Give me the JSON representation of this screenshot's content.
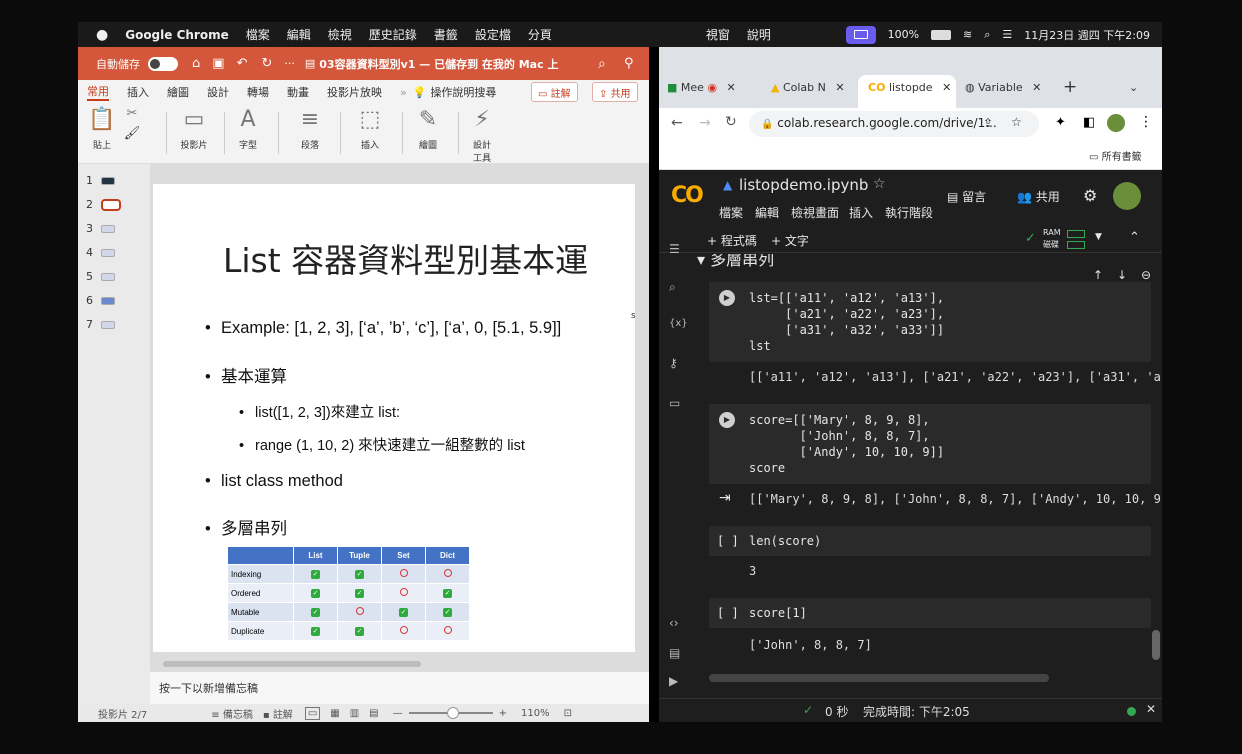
{
  "menubar": {
    "apple": "",
    "app": "Google Chrome",
    "items": [
      "檔案",
      "編輯",
      "檢視",
      "歷史記錄",
      "書籤",
      "設定檔",
      "分頁"
    ],
    "items_right": [
      "視窗",
      "說明"
    ],
    "battery": "100%",
    "datetime": "11月23日 週四 下午2:09"
  },
  "ppt": {
    "autosave": "自動儲存",
    "toggle_state": "關閉",
    "doc_title": "03容器資料型別v1 — 已儲存到 在我的 Mac 上",
    "tabs": [
      "常用",
      "插入",
      "繪圖",
      "設計",
      "轉場",
      "動畫",
      "投影片放映"
    ],
    "tell_me": "操作說明搜尋",
    "comment_btn": "註解",
    "share_btn": "共用",
    "ribbon": [
      {
        "label": "貼上",
        "icon": "paste-icon"
      },
      {
        "label": "投影片",
        "icon": "slide-icon"
      },
      {
        "label": "字型",
        "icon": "font-icon"
      },
      {
        "label": "段落",
        "icon": "paragraph-icon"
      },
      {
        "label": "插入",
        "icon": "insert-icon"
      },
      {
        "label": "繪圖",
        "icon": "draw-icon"
      },
      {
        "label": "設計\n工具",
        "icon": "designer-icon"
      }
    ],
    "thumbs": [
      "1",
      "2",
      "3",
      "4",
      "5",
      "6",
      "7"
    ],
    "slide": {
      "title": "List 容器資料型別基本運",
      "bullets": [
        "Example: [1, 2, 3], [‘a’, ’b’, ‘c’], [‘a’, 0, [5.1, 5.9]]",
        "基本運算",
        "list([1, 2, 3])來建立 list:",
        "range (1, 10, 2) 來快速建立一組整數的 list",
        "list class method",
        "多層串列"
      ],
      "side_mark": "s",
      "table": {
        "headers": [
          "",
          "List",
          "Tuple",
          "Set",
          "Dict"
        ],
        "rows": [
          {
            "name": "Indexing",
            "cells": [
              "check",
              "check",
              "no",
              "no"
            ]
          },
          {
            "name": "Ordered",
            "cells": [
              "check",
              "check",
              "no",
              "check"
            ]
          },
          {
            "name": "Mutable",
            "cells": [
              "check",
              "no",
              "check",
              "check"
            ]
          },
          {
            "name": "Duplicate",
            "cells": [
              "check",
              "check",
              "no",
              "no"
            ]
          }
        ]
      }
    },
    "notes_placeholder": "按一下以新增備忘稿",
    "status": {
      "slide": "投影片 2/7",
      "notes": "備忘稿",
      "comments": "註解",
      "zoom": "110%"
    }
  },
  "chrome": {
    "tabs": [
      "Mee",
      "Colab N",
      "listopde",
      "Variable"
    ],
    "new_tab": "+",
    "url": "colab.research.google.com/drive/1...",
    "bookmarks_all": "所有書籤"
  },
  "colab": {
    "logo": "CO",
    "filename": "listopdemo.ipynb",
    "menu": [
      "檔案",
      "編輯",
      "檢視畫面",
      "插入",
      "執行階段"
    ],
    "comment": "留言",
    "share": "共用",
    "add_code": "+ 程式碼",
    "add_text": "+ 文字",
    "ram": "RAM",
    "disk": "磁碟",
    "section": "多層串列",
    "cells": [
      {
        "code": [
          "lst=[['a11', 'a12', 'a13'],",
          "     ['a21', 'a22', 'a23'],",
          "     ['a31', 'a32', 'a33']]",
          "lst"
        ],
        "output": "[['a11', 'a12', 'a13'], ['a21', 'a22', 'a23'], ['a31', 'a"
      },
      {
        "code": [
          "score=[['Mary', 8, 9, 8],",
          "       ['John', 8, 8, 7],",
          "       ['Andy', 10, 10, 9]]",
          "score"
        ],
        "output": "[['Mary', 8, 9, 8], ['John', 8, 8, 7], ['Andy', 10, 10, 9"
      },
      {
        "prompt": "[ ]",
        "code": [
          "len(score)"
        ],
        "output": "3"
      },
      {
        "prompt": "[ ]",
        "code": [
          "score[1]"
        ],
        "output": "['John', 8, 8, 7]"
      }
    ],
    "status_time": "0 秒",
    "status_done": "完成時間: 下午2:05"
  }
}
